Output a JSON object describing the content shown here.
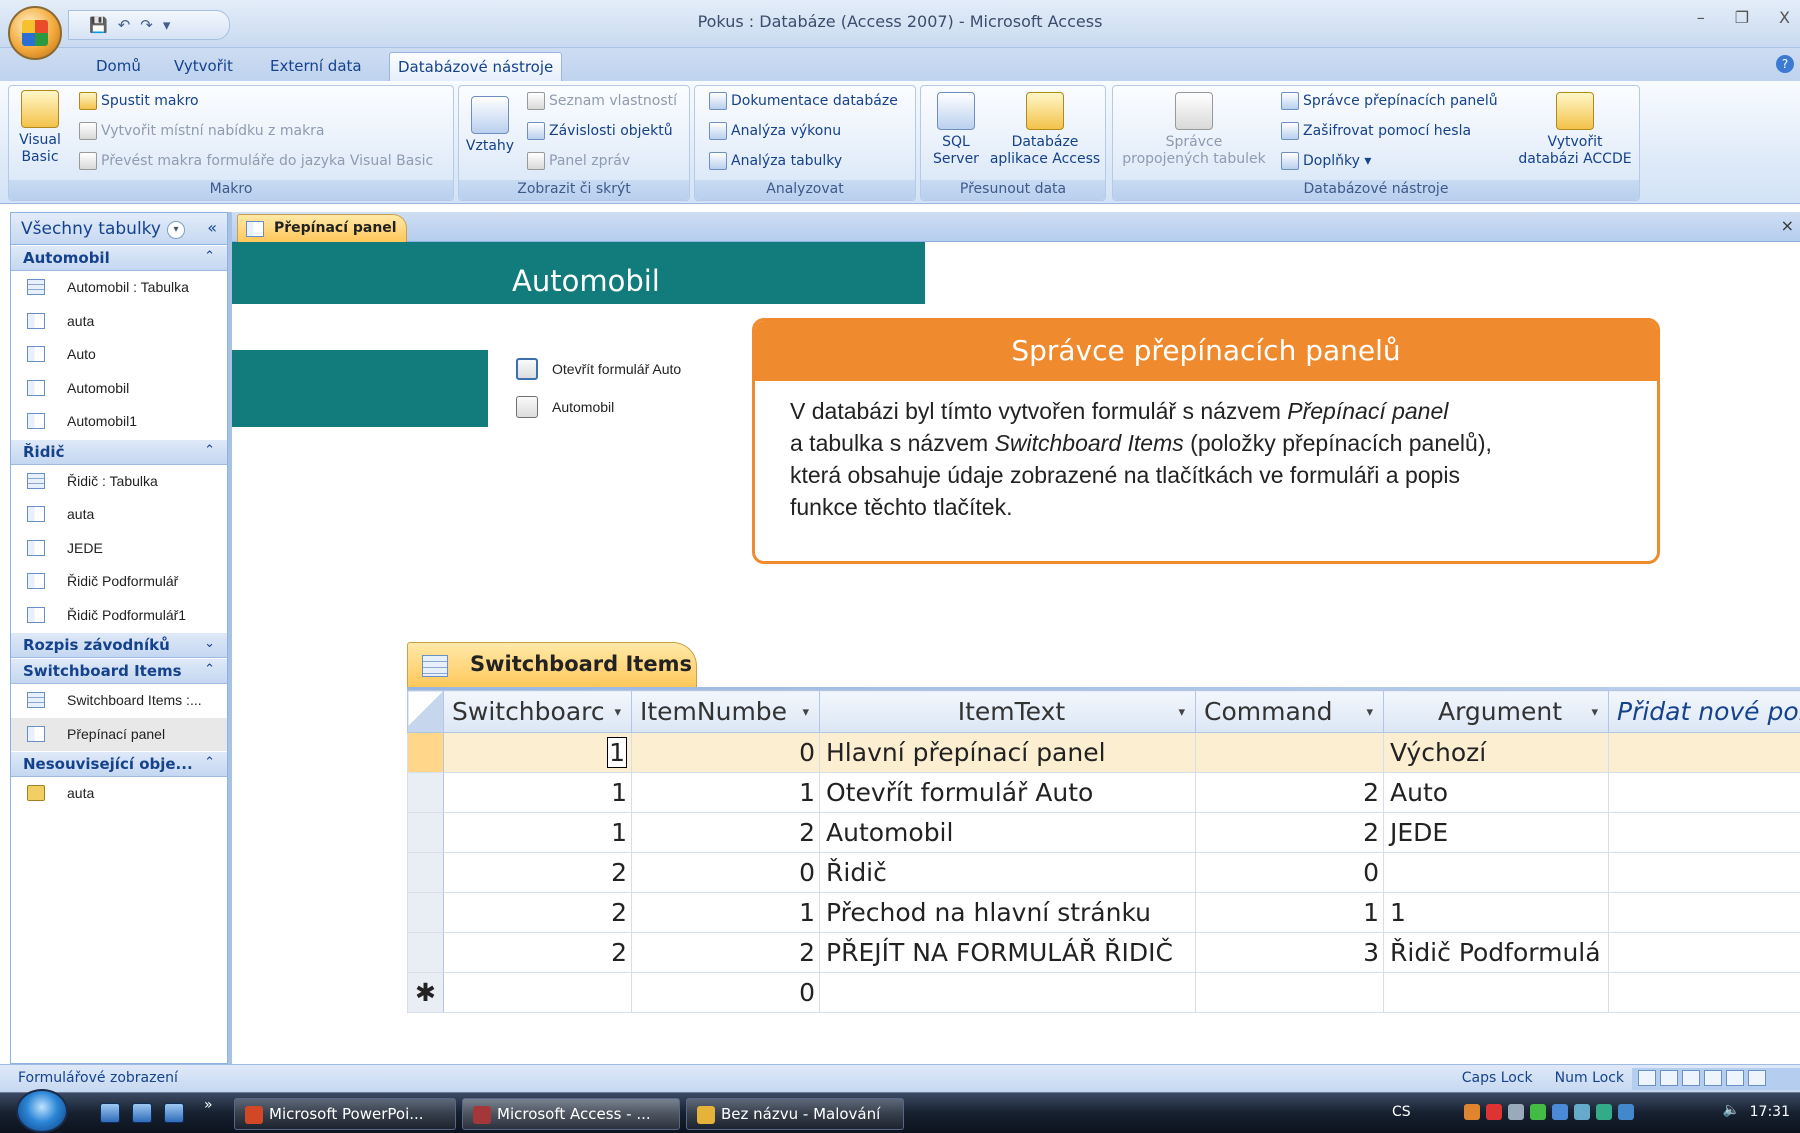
{
  "window": {
    "title": "Pokus : Databáze (Access 2007) - Microsoft Access",
    "min": "–",
    "restore": "❐",
    "close": "X"
  },
  "qat": {
    "save": "💾",
    "undo": "↶",
    "redo": "↷",
    "more": "▾"
  },
  "tabs": [
    {
      "label": "Domů"
    },
    {
      "label": "Vytvořit"
    },
    {
      "label": "Externí data"
    },
    {
      "label": "Databázové nástroje"
    }
  ],
  "ribbon": {
    "makro": {
      "label": "Makro",
      "visual_basic": "Visual Basic",
      "spustit_makro": "Spustit makro",
      "vytvorit_mistni": "Vytvořit místní nabídku z makra",
      "prevest": "Převést makra formuláře do jazyka Visual Basic"
    },
    "zobrazit": {
      "label": "Zobrazit či skrýt",
      "vztahy": "Vztahy",
      "seznam": "Seznam vlastností",
      "zavislosti": "Závislosti objektů",
      "panel_zprav": "Panel zpráv"
    },
    "analyzovat": {
      "label": "Analyzovat",
      "dokumentace": "Dokumentace databáze",
      "analyza_vykonu": "Analýza výkonu",
      "analyza_tabulky": "Analýza tabulky"
    },
    "presunout": {
      "label": "Přesunout data",
      "sql_line1": "SQL",
      "sql_line2": "Server",
      "databaze_line1": "Databáze",
      "databaze_line2": "aplikace Access"
    },
    "nastroje": {
      "label": "Databázové nástroje",
      "spravce_line1": "Správce",
      "spravce_line2": "propojených tabulek",
      "spravce_prepinacich": "Správce přepínacích panelů",
      "zasifrovat": "Zašifrovat pomocí hesla",
      "doplnky": "Doplňky ▾",
      "accde_line1": "Vytvořit",
      "accde_line2": "databázi ACCDE"
    }
  },
  "nav": {
    "title": "Všechny tabulky",
    "dropdown": "▾",
    "collapse": "«",
    "groups": {
      "automobil": {
        "label": "Automobil",
        "chev": "⌃",
        "items": [
          "Automobil : Tabulka",
          "auta",
          "Auto",
          "Automobil",
          "Automobil1"
        ]
      },
      "ridic": {
        "label": "Řidič",
        "chev": "⌃",
        "items": [
          "Řidič : Tabulka",
          "auta",
          "JEDE",
          "Řidič Podformulář",
          "Řidič Podformulář1"
        ]
      },
      "rozpis": {
        "label": "Rozpis závodníků",
        "chev": "⌄"
      },
      "switchboard": {
        "label": "Switchboard Items",
        "chev": "⌃",
        "items": [
          "Switchboard Items :...",
          "Přepínací panel"
        ]
      },
      "nesouvisejici": {
        "label": "Nesouvisející obje...",
        "chev": "⌃",
        "items": [
          "auta"
        ]
      }
    }
  },
  "doc": {
    "tab_label": "Přepínací panel",
    "close": "×"
  },
  "form": {
    "header": "Automobil",
    "buttons": [
      "Otevřít formulář Auto",
      "Automobil"
    ]
  },
  "callout": {
    "title": "Správce přepínacích panelů",
    "t1": "V databázi byl tímto vytvořen formulář s názvem ",
    "t1i": "Přepínací panel",
    "t2": "a tabulka s názvem ",
    "t2i": "Switchboard Items",
    "t3": " (položky přepínacích panelů),",
    "t4": "která obsahuje údaje zobrazené na tlačítkách ve formuláři a popis",
    "t5": "funkce těchto tlačítek."
  },
  "datasheet": {
    "tab_label": "Switchboard Items",
    "columns": [
      "Switchboarc",
      "ItemNumbe",
      "ItemText",
      "Command",
      "Argument",
      "Přidat nové pol"
    ],
    "rows": [
      [
        "1",
        "0",
        "Hlavní přepínací panel",
        "",
        "Výchozí"
      ],
      [
        "1",
        "1",
        "Otevřít formulář Auto",
        "2",
        "Auto"
      ],
      [
        "1",
        "2",
        "Automobil",
        "2",
        "JEDE"
      ],
      [
        "2",
        "0",
        "Řidič",
        "0",
        ""
      ],
      [
        "2",
        "1",
        "Přechod na hlavní stránku",
        "1",
        "1"
      ],
      [
        "2",
        "2",
        "PŘEJÍT NA FORMULÁŘ ŘIDIČ",
        "3",
        "Řidič Podformulá"
      ]
    ],
    "new_row": {
      "marker": "✱",
      "item_number": "0"
    }
  },
  "status": {
    "left": "Formulářové zobrazení",
    "caps": "Caps Lock",
    "num": "Num Lock"
  },
  "taskbar": {
    "more": "»",
    "tasks": [
      "Microsoft PowerPoi...",
      "Microsoft Access - ...",
      "Bez názvu - Malování"
    ],
    "lang": "CS",
    "clock": "17:31",
    "speaker": "🔈"
  }
}
